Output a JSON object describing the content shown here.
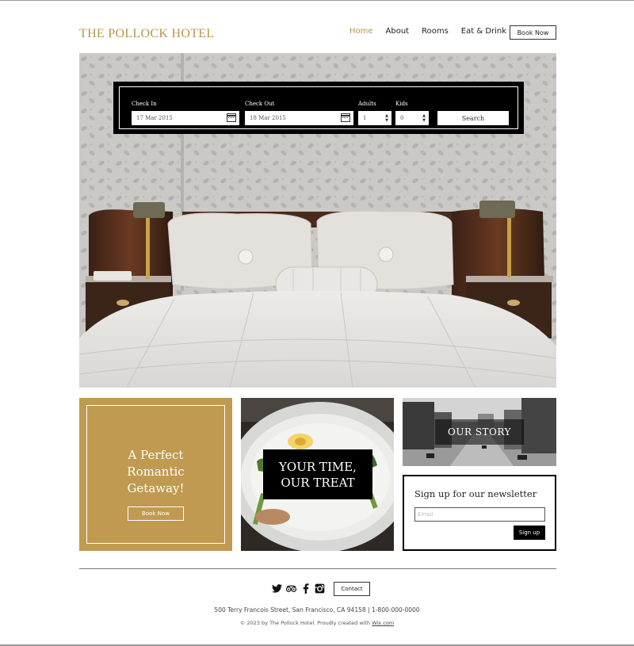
{
  "brand": {
    "name": "THE POLLOCK HOTEL",
    "color": "#b8954a"
  },
  "nav": {
    "items": [
      {
        "label": "Home"
      },
      {
        "label": "About"
      },
      {
        "label": "Rooms"
      },
      {
        "label": "Eat & Drink"
      }
    ],
    "active": "Home",
    "book_label": "Book Now"
  },
  "booking": {
    "check_in_label": "Check In",
    "check_in_value": "17 Mar 2015",
    "check_out_label": "Check Out",
    "check_out_value": "18 Mar 2015",
    "adults_label": "Adults",
    "adults_value": "1",
    "kids_label": "Kids",
    "kids_value": "0",
    "search_label": "Search"
  },
  "cards": {
    "getaway": {
      "line1": "A Perfect",
      "line2": "Romantic",
      "line3": "Getaway!",
      "button": "Book Now",
      "color": "#c09a50"
    },
    "treat": {
      "line1": "YOUR TIME,",
      "line2": "OUR TREAT"
    },
    "story": {
      "label": "OUR STORY"
    },
    "newsletter": {
      "title": "Sign up for our newsletter",
      "email_placeholder": "Email",
      "button": "Sign up"
    }
  },
  "footer": {
    "social_icons": [
      "twitter-icon",
      "tripadvisor-icon",
      "facebook-icon",
      "instagram-icon"
    ],
    "contact_label": "Contact",
    "address": "500 Terry Francois Street, San Francisco, CA 94158  |  1-800-000-0000",
    "copyright_prefix": "© 2023 by The Pollock Hotel. Proudly created with ",
    "copyright_link": "Wix.com"
  }
}
